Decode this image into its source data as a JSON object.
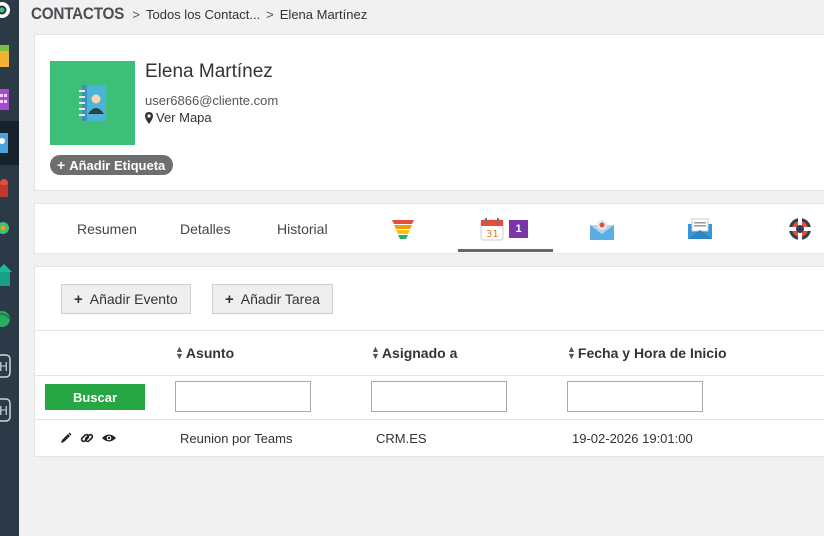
{
  "breadcrumb": {
    "module": "CONTACTOS",
    "list": "Todos los Contact...",
    "current": "Elena Martínez",
    "separator": ">"
  },
  "contact": {
    "name": "Elena Martínez",
    "email": "user6866@cliente.com",
    "map_link": "Ver Mapa",
    "add_tag": "Añadir Etiqueta"
  },
  "tabs": {
    "summary": "Resumen",
    "details": "Detalles",
    "history": "Historial",
    "calendar_badge": "1",
    "icon_tabs": [
      "funnel-icon",
      "calendar-icon",
      "email-notification-icon",
      "email-icon",
      "help-lifebuoy-icon"
    ]
  },
  "actions": {
    "add_event": "Añadir Evento",
    "add_task": "Añadir Tarea",
    "plus": "+"
  },
  "table": {
    "sort_glyph_up": "▲",
    "sort_glyph_down": "▼",
    "columns": [
      "Asunto",
      "Asignado a",
      "Fecha y Hora de Inicio"
    ],
    "search_button": "Buscar",
    "filters": [
      "",
      "",
      ""
    ],
    "rows": [
      {
        "subject": "Reunion por Teams",
        "assigned": "CRM.ES",
        "start": "19-02-2026 19:01:00"
      }
    ]
  },
  "colors": {
    "accent_green": "#27a744",
    "avatar_bg": "#3dbf7a",
    "badge_purple": "#7a35a8",
    "rail_bg": "#2c3a47"
  }
}
